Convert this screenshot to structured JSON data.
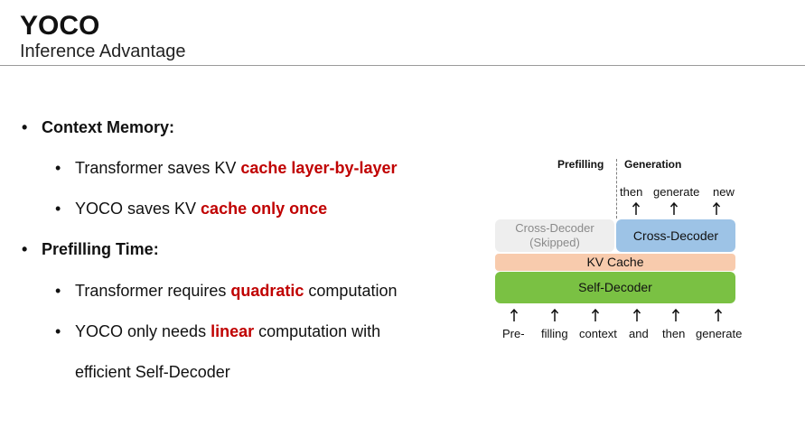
{
  "header": {
    "title": "YOCO",
    "subtitle": "Inference Advantage"
  },
  "bullets": {
    "b1": {
      "dot": "•",
      "label": "Context Memory:"
    },
    "b1a": {
      "dot": "•",
      "pre": "Transformer saves KV ",
      "hl": "cache layer-by-layer"
    },
    "b1b": {
      "dot": "•",
      "pre": "YOCO saves KV ",
      "hl": "cache only once"
    },
    "b2": {
      "dot": "•",
      "label": "Prefilling Time:"
    },
    "b2a": {
      "dot": "•",
      "pre": "Transformer requires ",
      "hl": "quadratic",
      "post": " computation"
    },
    "b2b": {
      "dot": "•",
      "pre": "YOCO only needs ",
      "hl": "linear",
      "post": " computation with"
    },
    "b2b_cont": "efficient Self-Decoder"
  },
  "diagram": {
    "prefilling_label": "Prefilling",
    "generation_label": "Generation",
    "outputs": [
      "then",
      "generate",
      "new"
    ],
    "cross_skipped_line1": "Cross-Decoder",
    "cross_skipped_line2": "(Skipped)",
    "cross_decoder": "Cross-Decoder",
    "kv_cache": "KV Cache",
    "self_decoder": "Self-Decoder",
    "inputs": [
      "Pre-",
      "filling",
      "context",
      "and",
      "then",
      "generate"
    ],
    "colors": {
      "highlight": "#c00000",
      "skipped_box": "#eeeeee",
      "cross_box": "#9dc3e6",
      "kv_box": "#f8cbad",
      "self_box": "#7ac143"
    }
  }
}
